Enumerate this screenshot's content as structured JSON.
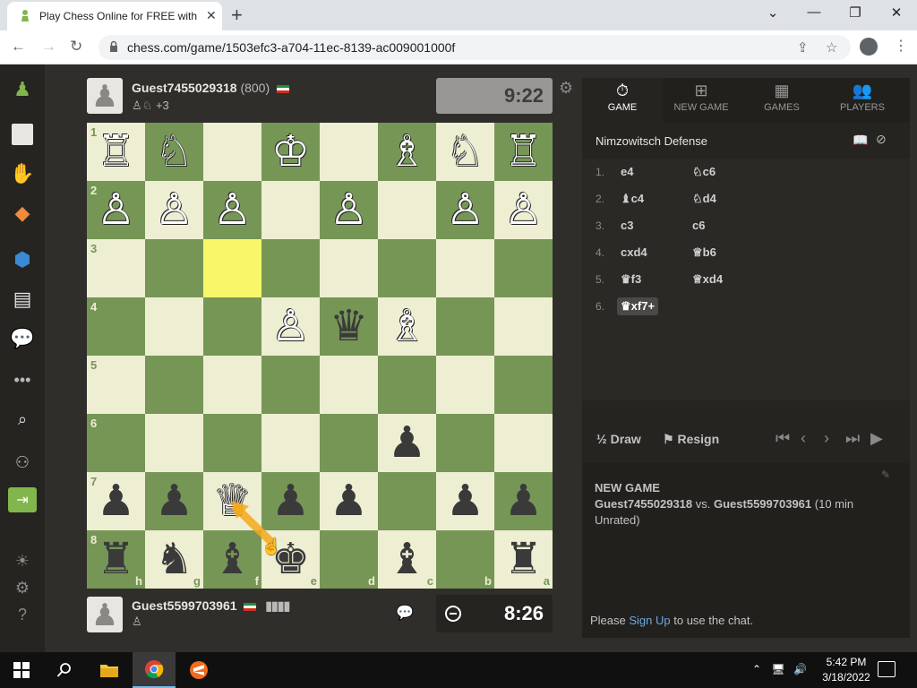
{
  "browser": {
    "tab_title": "Play Chess Online for FREE with F",
    "url": "chess.com/game/1503efc3-a704-11ec-8139-ac009001000f"
  },
  "top_player": {
    "name": "Guest7455029318",
    "rating": "(800)",
    "captured_extra": "+3",
    "clock": "9:22"
  },
  "bottom_player": {
    "name": "Guest5599703961",
    "clock": "8:26"
  },
  "board": {
    "rank_labels": [
      "1",
      "2",
      "3",
      "4",
      "5",
      "6",
      "7",
      "8"
    ],
    "file_labels": [
      "h",
      "g",
      "f",
      "e",
      "d",
      "c",
      "b",
      "a"
    ]
  },
  "panel": {
    "tabs": [
      {
        "label": "GAME",
        "icon": "stopwatch-icon"
      },
      {
        "label": "NEW GAME",
        "icon": "plus-board-icon"
      },
      {
        "label": "GAMES",
        "icon": "chessboard-icon"
      },
      {
        "label": "PLAYERS",
        "icon": "people-icon"
      }
    ],
    "opening": "Nimzowitsch Defense",
    "moves": [
      {
        "n": "1.",
        "w": "e4",
        "b": "♘c6"
      },
      {
        "n": "2.",
        "w": "♝c4",
        "b": "♘d4"
      },
      {
        "n": "3.",
        "w": "c3",
        "b": "c6"
      },
      {
        "n": "4.",
        "w": "cxd4",
        "b": "♕b6"
      },
      {
        "n": "5.",
        "w": "♛f3",
        "b": "♕xd4"
      },
      {
        "n": "6.",
        "w": "♛xf7+",
        "b": ""
      }
    ],
    "draw_label": "Draw",
    "draw_prefix": "½",
    "resign_label": "Resign",
    "chat": {
      "title": "NEW GAME",
      "line_players": "Guest7455029318",
      "line_vs": " vs. ",
      "line_opponent": "Guest5599703961",
      "line_rest": " (10 min Unrated)",
      "please": "Please ",
      "signup": "Sign Up",
      "tail": " to use the chat."
    }
  },
  "taskbar": {
    "time": "5:42 PM",
    "date": "3/18/2022"
  }
}
